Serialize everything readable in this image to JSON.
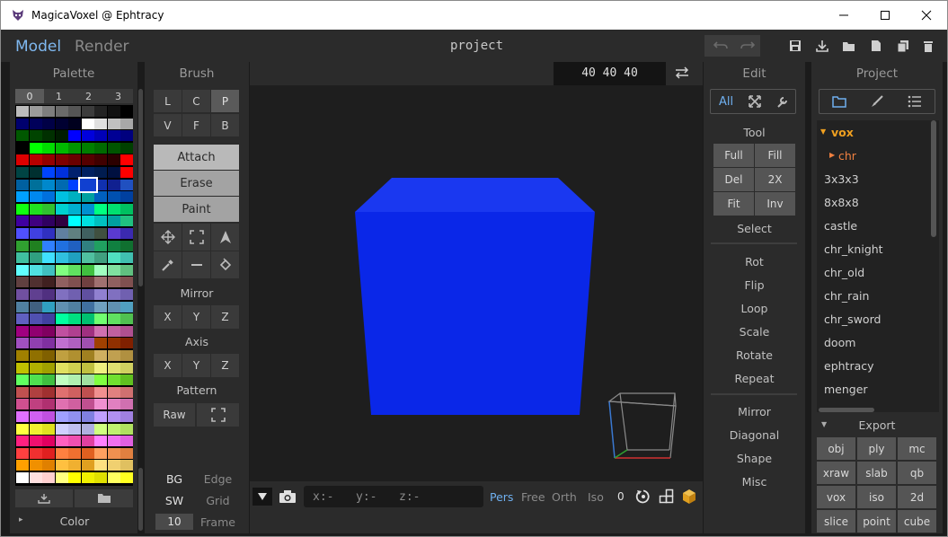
{
  "window": {
    "title": "MagicaVoxel @ Ephtracy"
  },
  "modes": {
    "model": "Model",
    "render": "Render"
  },
  "project_name": "project",
  "palette": {
    "title": "Palette",
    "tabs": [
      "0",
      "1",
      "2",
      "3"
    ],
    "footer_label": "Color",
    "rows": [
      [
        "#bcbcbc",
        "#9b9b9b",
        "#7e7e7e",
        "#6a6a6a",
        "#555555",
        "#3c3c3c",
        "#232323",
        "#111111",
        "#000000"
      ],
      [
        "#00006e",
        "#00005a",
        "#000046",
        "#000032",
        "#00001e",
        "#ffffff",
        "#e0e0e0",
        "#c0c0c0",
        "#a8a8a8"
      ],
      [
        "#005800",
        "#004400",
        "#003000",
        "#001c00",
        "#0000ff",
        "#0000dc",
        "#0000b8",
        "#000094",
        "#00007e"
      ],
      [
        "#000000",
        "#00ff00",
        "#00dc00",
        "#00b800",
        "#009400",
        "#007e00",
        "#006a00",
        "#005500",
        "#004000"
      ],
      [
        "#dc0000",
        "#b80000",
        "#940000",
        "#7e0000",
        "#6a0000",
        "#550000",
        "#400000",
        "#2c0000",
        "#ff0000"
      ],
      [
        "#004444",
        "#003030",
        "#0044ff",
        "#0030dc",
        "#00206e",
        "#002060",
        "#001c50",
        "#001040",
        "#ff0000"
      ],
      [
        "#0060a0",
        "#00709a",
        "#0088cc",
        "#006ab0",
        "#0040ff",
        "#1040d0",
        "#1030b0",
        "#102090",
        "#2050c0"
      ],
      [
        "#00a0ff",
        "#0088ee",
        "#0070dd",
        "#00c0e0",
        "#00b0c0",
        "#00a0a0",
        "#0060c0",
        "#0050b0",
        "#0040a0"
      ],
      [
        "#10ff10",
        "#20e020",
        "#30c030",
        "#00d0d0",
        "#00b0d0",
        "#0090d0",
        "#00ff80",
        "#00e070",
        "#00c060"
      ],
      [
        "#4000a0",
        "#400080",
        "#300060",
        "#300040",
        "#00ffff",
        "#00e0e0",
        "#00c0c0",
        "#00a0a0",
        "#20c080"
      ],
      [
        "#5050ff",
        "#4040e0",
        "#3030c0",
        "#6080a0",
        "#608080",
        "#406060",
        "#405040",
        "#5a3ad0",
        "#3b2ab0"
      ],
      [
        "#30a030",
        "#208020",
        "#3080ff",
        "#2070e0",
        "#2060c0",
        "#308080",
        "#20a060",
        "#108040",
        "#107030"
      ],
      [
        "#40c0a0",
        "#30a080",
        "#40e0ff",
        "#30c0e0",
        "#20a0c0",
        "#50c0a0",
        "#40a080",
        "#50e0c0",
        "#40c0b0"
      ],
      [
        "#60ffff",
        "#50e0e0",
        "#40c0c0",
        "#80ff80",
        "#60e060",
        "#40c040",
        "#a0ffc0",
        "#80e0a0",
        "#60c080"
      ],
      [
        "#604040",
        "#503030",
        "#402020",
        "#906060",
        "#805050",
        "#704040",
        "#a07070",
        "#906060",
        "#805050"
      ],
      [
        "#7050a0",
        "#604090",
        "#503080",
        "#8070c0",
        "#7060b0",
        "#6050a0",
        "#9080d0",
        "#8070c0",
        "#7060b0"
      ],
      [
        "#5080a0",
        "#406080",
        "#30a0c0",
        "#6090b0",
        "#5080a0",
        "#4070a0",
        "#70a0c0",
        "#6090b0",
        "#50a0c0"
      ],
      [
        "#6060c0",
        "#5050b0",
        "#4040a0",
        "#00ff9f",
        "#00e080",
        "#00c070",
        "#70ff70",
        "#60e060",
        "#50c050"
      ],
      [
        "#a00080",
        "#900070",
        "#800060",
        "#c050a0",
        "#b04090",
        "#a03080",
        "#d070b0",
        "#c060a0",
        "#b05090"
      ],
      [
        "#a050c0",
        "#9040b0",
        "#8030a0",
        "#c070d0",
        "#b060c0",
        "#a050b0",
        "#a04000",
        "#903000",
        "#802000"
      ],
      [
        "#a08000",
        "#907000",
        "#806000",
        "#c0a040",
        "#b09030",
        "#a08020",
        "#d0b060",
        "#c0a050",
        "#b09040"
      ],
      [
        "#c0c000",
        "#b0b000",
        "#a0a000",
        "#e0e060",
        "#d0d050",
        "#c0c040",
        "#f0f080",
        "#e0e070",
        "#d0d060"
      ],
      [
        "#60ff60",
        "#50e050",
        "#40c040",
        "#c0ffc0",
        "#b0f0b0",
        "#a0e0a0",
        "#80ff40",
        "#70e030",
        "#60c020"
      ],
      [
        "#c05050",
        "#b04040",
        "#a03030",
        "#e07070",
        "#d06060",
        "#c05050",
        "#f09090",
        "#e08080",
        "#d07070"
      ],
      [
        "#d05090",
        "#c04080",
        "#b03070",
        "#e070b0",
        "#d060a0",
        "#c05090",
        "#f090d0",
        "#e080c0",
        "#d070b0"
      ],
      [
        "#e070ff",
        "#d060f0",
        "#c050e0",
        "#a0a0ff",
        "#9090f0",
        "#8080e0",
        "#c0a0ff",
        "#b090f0",
        "#a080e0"
      ],
      [
        "#ffff40",
        "#f0f030",
        "#e0e020",
        "#d0d0ff",
        "#c0c0f0",
        "#b0b0e0",
        "#d0ff80",
        "#c0f070",
        "#b0e060"
      ],
      [
        "#ff2080",
        "#f01070",
        "#e00060",
        "#ff60c0",
        "#f050b0",
        "#e040a0",
        "#ff80ff",
        "#f070f0",
        "#e060e0"
      ],
      [
        "#ff4040",
        "#f03030",
        "#e02020",
        "#ff8040",
        "#f07030",
        "#e06020",
        "#ffa060",
        "#f09050",
        "#e08040"
      ],
      [
        "#ffa000",
        "#f09000",
        "#e08000",
        "#ffc040",
        "#f0b030",
        "#e0a020",
        "#ffe080",
        "#f0d070",
        "#e0c060"
      ],
      [
        "#ffffff",
        "#ffe0e0",
        "#ffd0d0",
        "#ffff80",
        "#ffff00",
        "#f0f000",
        "#e0e000",
        "#ffff60",
        "#ffff20"
      ]
    ],
    "selected_row": 6,
    "selected_col": 5
  },
  "brush": {
    "title": "Brush",
    "types": [
      [
        "L",
        "C",
        "P"
      ],
      [
        "V",
        "F",
        "B"
      ]
    ],
    "active_type": "P",
    "modes": [
      "Attach",
      "Erase",
      "Paint"
    ],
    "active_mode": "Attach",
    "mirror_label": "Mirror",
    "mirror_axes": [
      "X",
      "Y",
      "Z"
    ],
    "axis_label": "Axis",
    "axis_axes": [
      "X",
      "Y",
      "Z"
    ],
    "pattern_label": "Pattern",
    "pattern_raw": "Raw",
    "bg": "BG",
    "edge": "Edge",
    "sw": "SW",
    "grid": "Grid",
    "frame_value": "10",
    "frame": "Frame"
  },
  "viewport": {
    "dimensions": "40 40 40",
    "cube_color": "#0a27e8",
    "coords": {
      "x": "x:-",
      "y": "y:-",
      "z": "z:-"
    },
    "camera_modes": [
      "Pers",
      "Free",
      "Orth",
      "Iso"
    ],
    "active_camera": "Pers",
    "camera_value": "0"
  },
  "edit": {
    "title": "Edit",
    "tabs_all": "All",
    "tool_label": "Tool",
    "tool_buttons": [
      [
        "Full",
        "Fill"
      ],
      [
        "Del",
        "2X"
      ],
      [
        "Fit",
        "Inv"
      ]
    ],
    "select": "Select",
    "transform_items": [
      "Rot",
      "Flip",
      "Loop",
      "Scale",
      "Rotate",
      "Repeat"
    ],
    "misc_items": [
      "Mirror",
      "Diagonal",
      "Shape",
      "Misc"
    ]
  },
  "project": {
    "title": "Project",
    "folder_vox": "vox",
    "folder_chr": "chr",
    "items": [
      "3x3x3",
      "8x8x8",
      "castle",
      "chr_knight",
      "chr_old",
      "chr_rain",
      "chr_sword",
      "doom",
      "ephtracy",
      "menger"
    ],
    "export_label": "Export",
    "export_buttons": [
      [
        "obj",
        "ply",
        "mc"
      ],
      [
        "xraw",
        "slab",
        "qb"
      ],
      [
        "vox",
        "iso",
        "2d"
      ],
      [
        "slice",
        "point",
        "cube"
      ]
    ]
  },
  "colors": {
    "accent_blue": "#6fb0f0",
    "folder_orange": "#f0a020"
  }
}
